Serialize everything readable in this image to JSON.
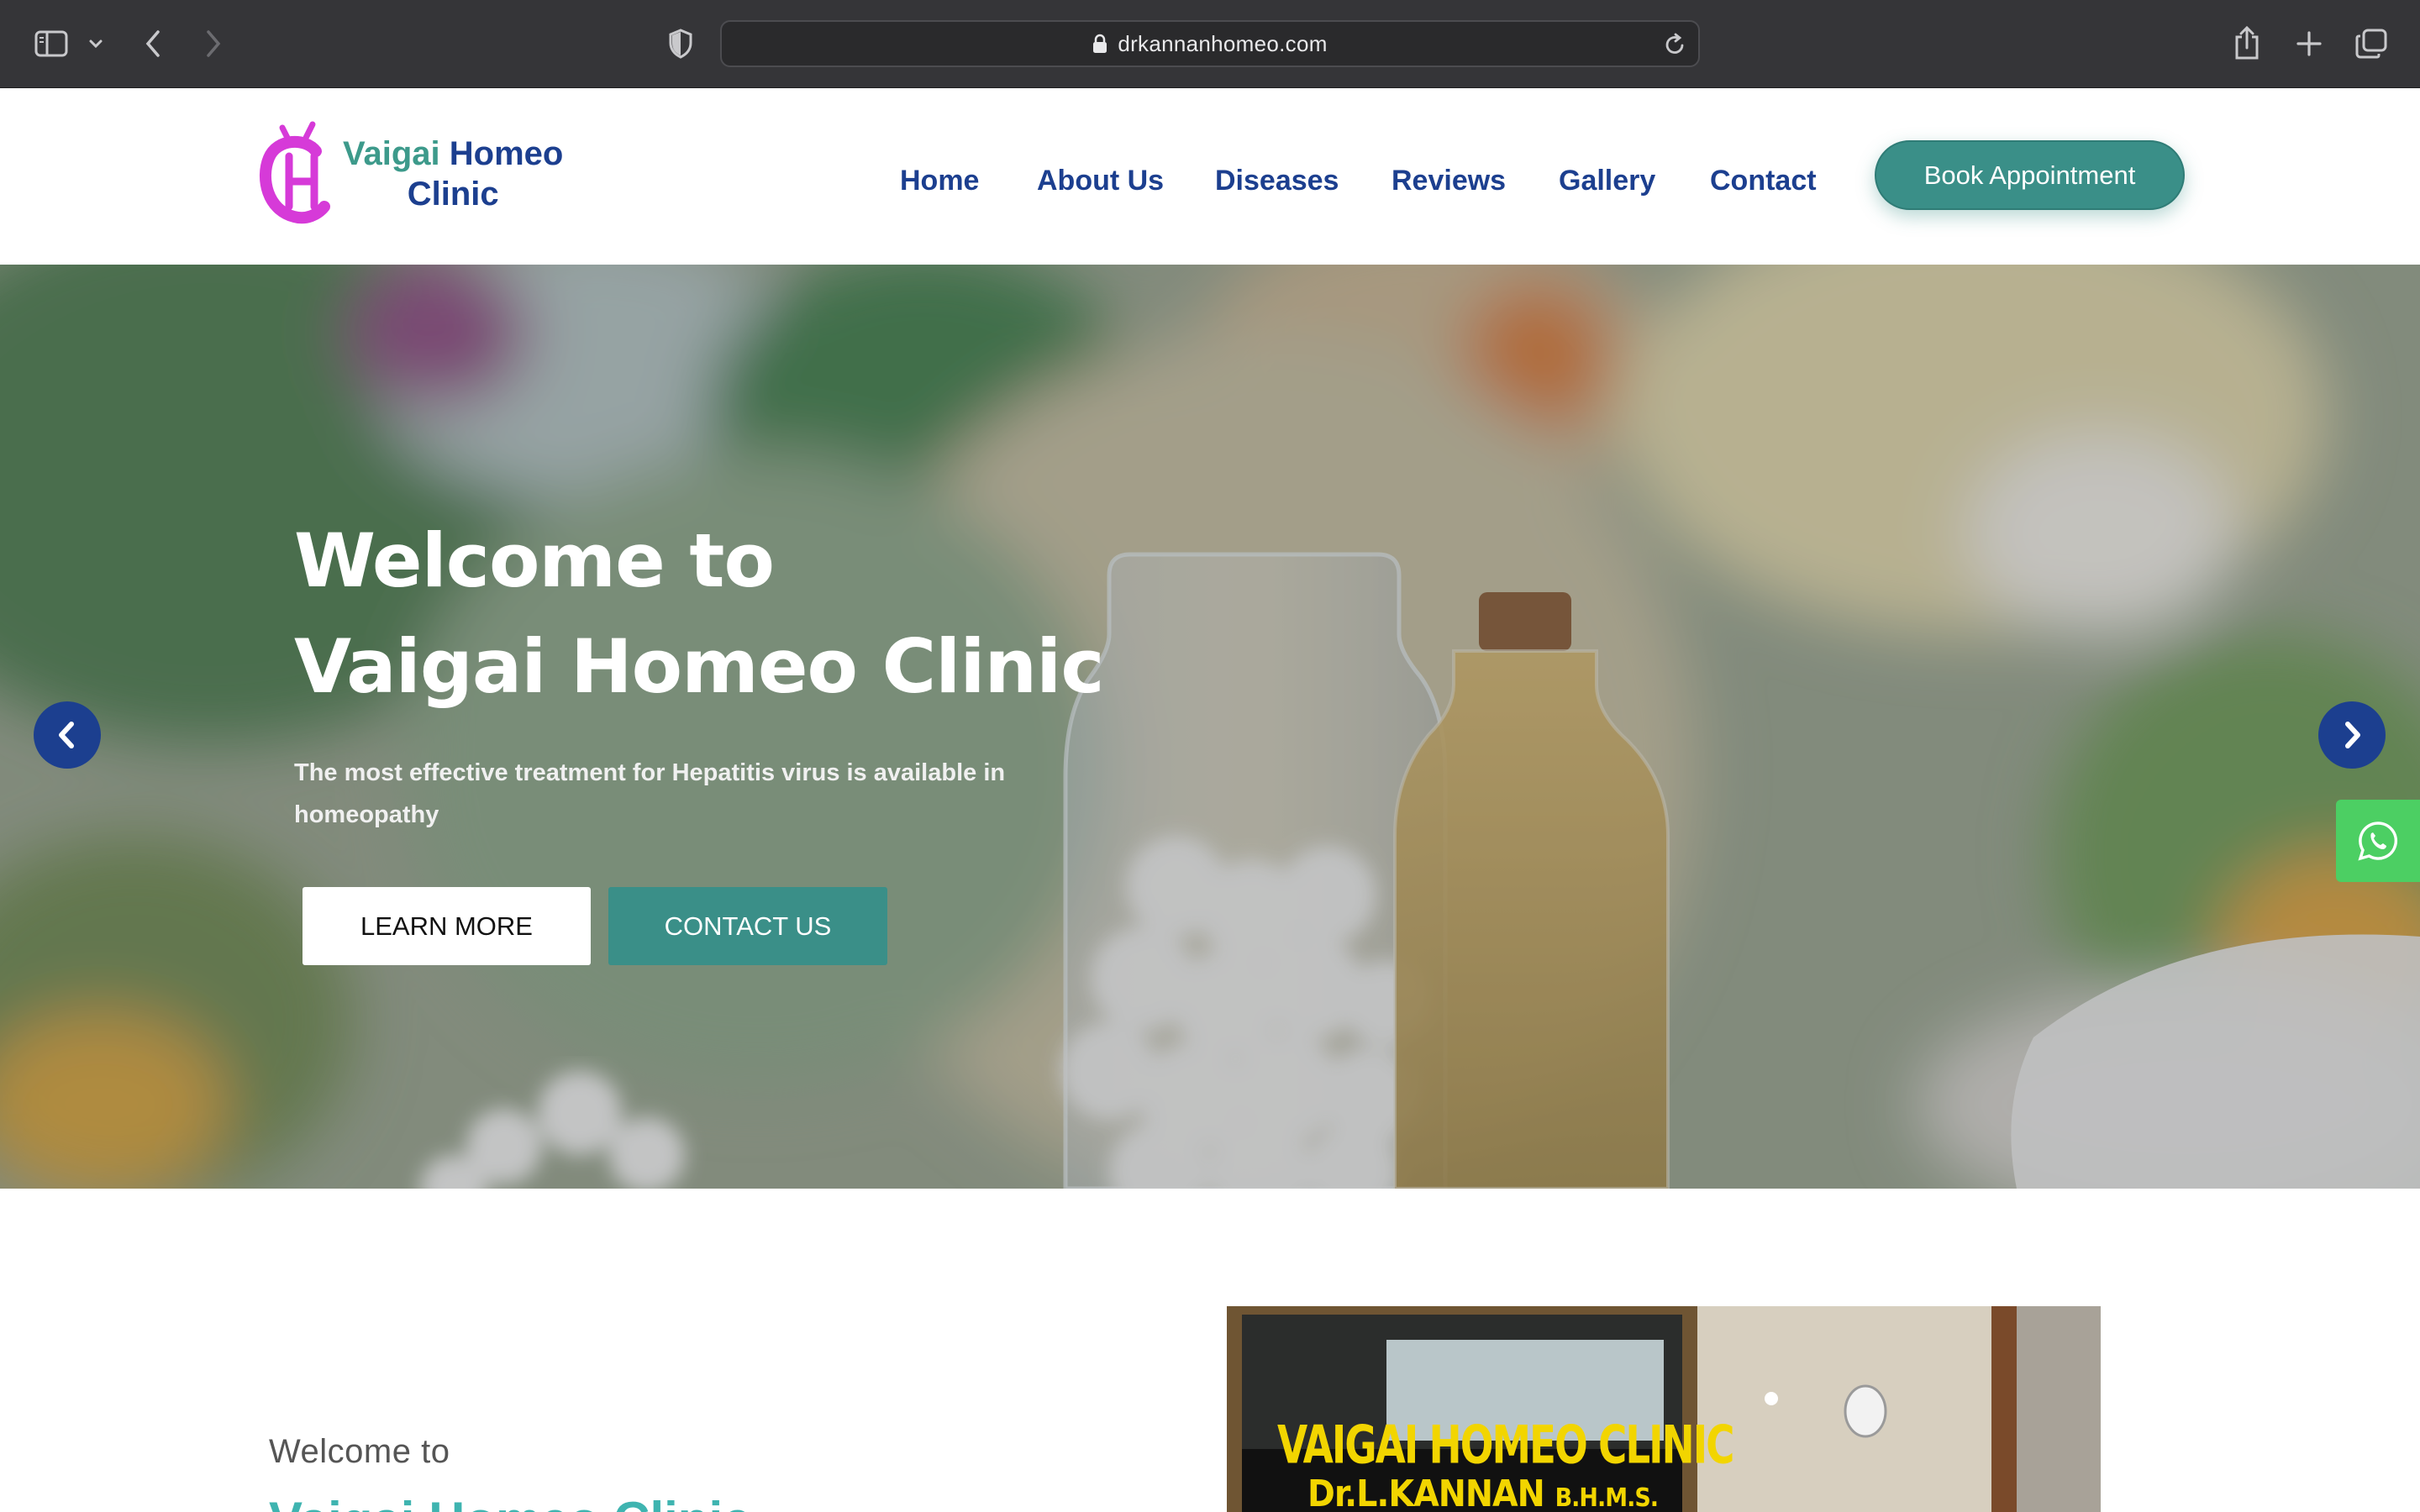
{
  "browser": {
    "url": "drkannanhomeo.com"
  },
  "brand": {
    "name_line1_part1": "Vaigai",
    "name_line1_part2": "Homeo",
    "name_line2": "Clinic",
    "colors": {
      "teal": "#3d9a8b",
      "navy": "#1c3f8f",
      "magenta": "#d63ad8"
    }
  },
  "nav": {
    "items": [
      {
        "label": "Home"
      },
      {
        "label": "About Us"
      },
      {
        "label": "Diseases"
      },
      {
        "label": "Reviews"
      },
      {
        "label": "Gallery"
      },
      {
        "label": "Contact"
      }
    ],
    "cta": "Book Appointment"
  },
  "hero": {
    "title_line1": "Welcome to",
    "title_line2": "Vaigai Homeo Clinic",
    "subtitle": "The most effective treatment for Hepatitis virus is available in homeopathy",
    "learn_more": "LEARN MORE",
    "contact_us": "CONTACT US",
    "prev_icon": "chevron-left-icon",
    "next_icon": "chevron-right-icon",
    "whatsapp_icon": "whatsapp-icon"
  },
  "intro": {
    "kicker": "Welcome to",
    "heading": "Vaigai Homeo Clinic"
  },
  "photo": {
    "sign_line1": "VAIGAI HOMEO CLINIC",
    "sign_line2": "Dr.L.KANNAN",
    "sign_degree": "B.H.M.S."
  }
}
